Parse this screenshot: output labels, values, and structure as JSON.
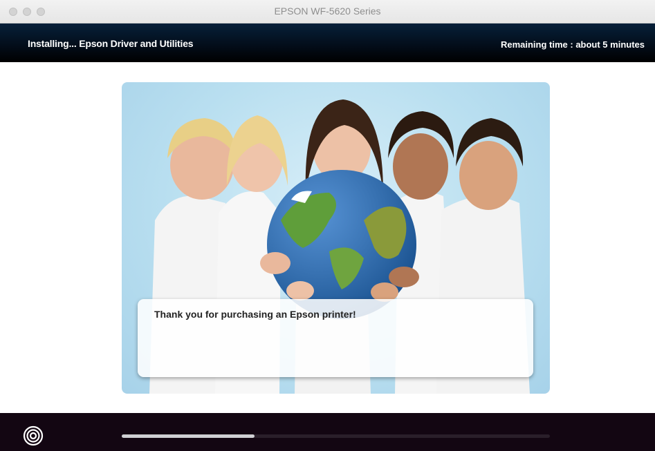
{
  "window": {
    "title": "EPSON WF-5620 Series"
  },
  "header": {
    "status": "Installing...  Epson Driver and Utilities",
    "remaining": "Remaining time : about 5 minutes"
  },
  "hero": {
    "image": "children-holding-globe",
    "message": "Thank you for purchasing an Epson printer!"
  },
  "footer": {
    "logo_icon": "epson-spiral-icon",
    "progress_fraction": 0.31
  },
  "colors": {
    "header_bg": "#030c18",
    "footer_bg": "#130612",
    "progress_fill": "#cfcfd3",
    "hero_bg": "#b9dff0"
  }
}
